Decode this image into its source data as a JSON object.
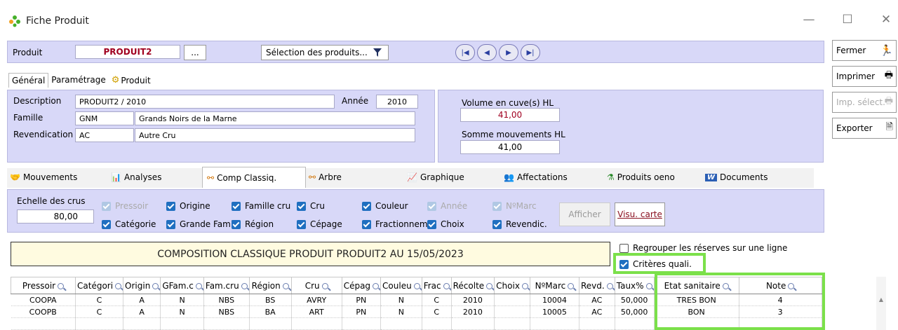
{
  "window": {
    "title": "Fiche Produit",
    "min_glyph": "—",
    "max_glyph": "☐",
    "close_glyph": "✕"
  },
  "header": {
    "produit_label": "Produit",
    "produit_value": "PRODUIT2",
    "ellipsis_label": "...",
    "selection_label": "Sélection des produits...",
    "nav": {
      "first": "|◀",
      "prev": "◀",
      "next": "▶",
      "last": "▶|"
    }
  },
  "side_buttons": [
    {
      "label": "Fermer",
      "icon": "runner-icon"
    },
    {
      "label": "Imprimer",
      "icon": "printer-icon"
    },
    {
      "label": "Imp. sélect.",
      "icon": "printer-icon"
    },
    {
      "label": "Exporter",
      "icon": "export-icon"
    }
  ],
  "top_tabs": [
    "Général",
    "Paramétrage",
    "Produit"
  ],
  "general": {
    "description_label": "Description",
    "description_value": "PRODUIT2 / 2010",
    "annee_label": "Année",
    "annee_value": "2010",
    "famille_label": "Famille",
    "famille_code": "GNM",
    "famille_name": "Grands Noirs de la Marne",
    "revendication_label": "Revendication",
    "revendication_code": "AC",
    "revendication_name": "Autre Cru",
    "volume_label": "Volume en cuve(s) HL",
    "volume_value": "41,00",
    "somme_label": "Somme mouvements HL",
    "somme_value": "41,00"
  },
  "sub_tabs": [
    "Mouvements",
    "Analyses",
    "Comp Classiq.",
    "Arbre",
    "Graphique",
    "Affectations",
    "Produits oeno",
    "Documents"
  ],
  "criteria": {
    "echelle_label": "Echelle des crus",
    "echelle_value": "80,00",
    "row1": [
      {
        "label": "Pressoir",
        "state": "disabled"
      },
      {
        "label": "Origine",
        "state": "checked"
      },
      {
        "label": "Famille cru",
        "state": "checked"
      },
      {
        "label": "Cru",
        "state": "checked"
      },
      {
        "label": "Couleur",
        "state": "checked"
      },
      {
        "label": "Année",
        "state": "disabled"
      },
      {
        "label": "NºMarc",
        "state": "disabled"
      }
    ],
    "row2": [
      {
        "label": "Catégorie",
        "state": "checked"
      },
      {
        "label": "Grande Fami",
        "state": "checked"
      },
      {
        "label": "Région",
        "state": "checked"
      },
      {
        "label": "Cépage",
        "state": "checked"
      },
      {
        "label": "Fractionnem",
        "state": "checked"
      },
      {
        "label": "Choix",
        "state": "checked"
      },
      {
        "label": "Revendic.",
        "state": "checked"
      }
    ],
    "afficher_label": "Afficher",
    "visu_label": "Visu. carte"
  },
  "composition_title": "COMPOSITION CLASSIQUE PRODUIT  PRODUIT2 AU  15/05/2023",
  "options": {
    "regrouper_label": "Regrouper les réserves sur une ligne",
    "criteres_label": "Critères quali."
  },
  "table": {
    "columns": [
      "Pressoir",
      "Catégori",
      "Origin",
      "GFam.c",
      "Fam.cru",
      "Région",
      "Cru",
      "Cépag",
      "Couleu",
      "Frac",
      "Récolte",
      "Choix",
      "NºMarc",
      "Revd.",
      "Taux%",
      "Etat sanitaire",
      "Note"
    ],
    "rows": [
      [
        "COOPA",
        "C",
        "A",
        "N",
        "NBS",
        "BS",
        "AVRY",
        "PN",
        "N",
        "C",
        "2010",
        "",
        "10004",
        "AC",
        "50,000",
        "TRES BON",
        "4"
      ],
      [
        "COOPB",
        "C",
        "A",
        "N",
        "NBS",
        "BA",
        "ART",
        "PN",
        "N",
        "C",
        "2010",
        "",
        "10005",
        "AC",
        "50,000",
        "BON",
        "3"
      ]
    ]
  },
  "colors": {
    "lavender": "#d8d8f8",
    "highlight_green": "#7be04a",
    "checkbox_blue": "#1f6fc0",
    "produit_red": "#a00020",
    "title_yellow": "#fffbe0"
  }
}
